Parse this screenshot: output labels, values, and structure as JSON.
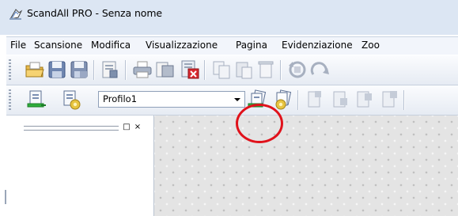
{
  "window": {
    "title": "ScandAll PRO - Senza nome"
  },
  "menu": {
    "items": [
      "File",
      "Scansione",
      "Modifica",
      "Visualizzazione",
      "Pagina",
      "Evidenziazione",
      "Zoo"
    ]
  },
  "toolbar1": {
    "icons": [
      "open-folder-icon",
      "save-icon",
      "save-as-icon",
      "properties-icon",
      "print-icon",
      "print-preview-icon",
      "close-document-icon",
      "copy-icon",
      "paste-icon",
      "delete-page-icon",
      "rotate-left-icon",
      "rotate-right-icon"
    ]
  },
  "toolbar2": {
    "profile_value": "Profilo1",
    "icons": [
      "scan-icon",
      "scan-settings-icon",
      "scan-with-profile-icon",
      "profile-settings-icon",
      "batch-page-icon-1",
      "batch-page-icon-2",
      "batch-page-icon-3",
      "batch-page-icon-4"
    ]
  },
  "left_panel": {
    "pin_glyph": "□",
    "close_glyph": "×"
  },
  "colors": {
    "highlight": "#e0121b",
    "titlebar": "#dce6f3",
    "workspace": "#e4e4e4"
  }
}
